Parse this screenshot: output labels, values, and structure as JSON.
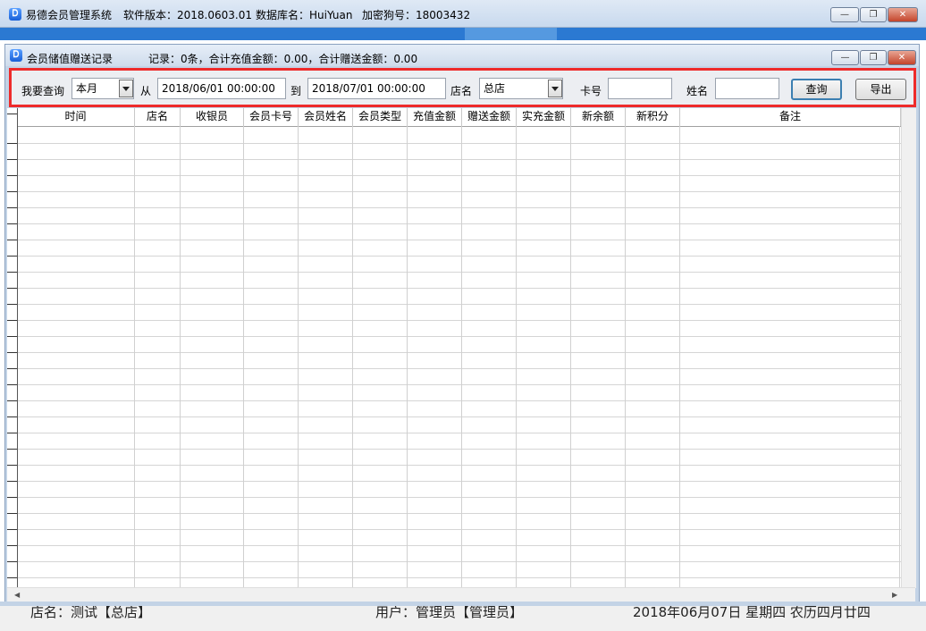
{
  "app": {
    "title": "易德会员管理系统",
    "version_label": "软件版本：2018.0603.01",
    "database_label": "数据库名：HuiYuan",
    "dongle_label": "加密狗号：18003432",
    "icon_glyph": "Ꭰ"
  },
  "inner_window": {
    "title": "会员储值赠送记录",
    "summary": "记录：0条，合计充值金额：0.00，合计赠送金额：0.00"
  },
  "window_controls": {
    "minimize": "—",
    "restore": "❐",
    "close": "✕"
  },
  "toolbar": {
    "query_label": "我要查询",
    "period_value": "本月",
    "from_label": "从",
    "from_date": "2018/06/01 00:00:00",
    "to_label": "到",
    "to_date": "2018/07/01 00:00:00",
    "store_label": "店名",
    "store_value": "总店",
    "card_label": "卡号",
    "card_value": "",
    "name_label": "姓名",
    "name_value": "",
    "query_button": "查询",
    "export_button": "导出"
  },
  "grid": {
    "columns": [
      "时间",
      "店名",
      "收银员",
      "会员卡号",
      "会员姓名",
      "会员类型",
      "充值金额",
      "赠送金额",
      "实充金额",
      "新余额",
      "新积分",
      "备注"
    ],
    "rows": []
  },
  "status": {
    "store": "店名：测试【总店】",
    "user": "用户：管理员【管理员】",
    "date": "2018年06月07日 星期四 农历四月廿四"
  },
  "colors": {
    "accent_red": "#ee2b2b",
    "band_blue": "#2b79d2"
  }
}
